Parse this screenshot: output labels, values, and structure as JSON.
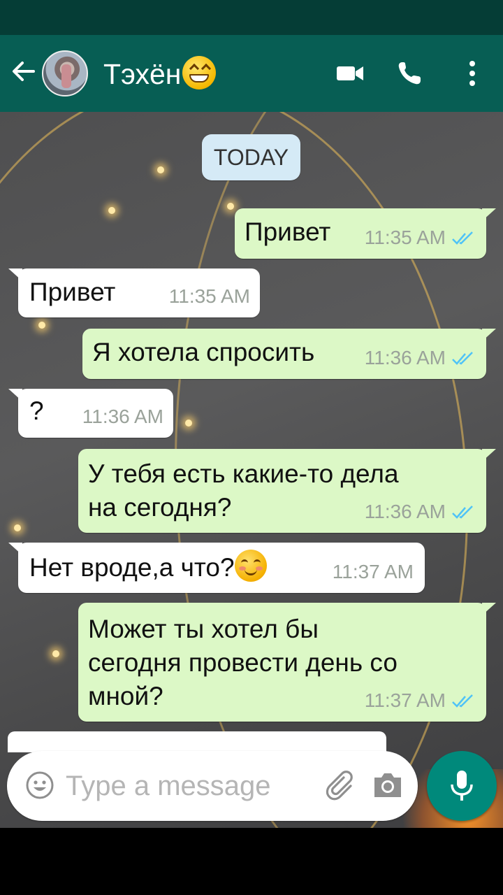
{
  "header": {
    "contact_name": "Тэхён",
    "name_emoji": "grinning-face-icon"
  },
  "chat": {
    "date_chip": "TODAY",
    "messages": [
      {
        "dir": "out",
        "text": "Привет",
        "time": "11:35 AM",
        "status": "read"
      },
      {
        "dir": "in",
        "text": "Привет",
        "time": "11:35 AM"
      },
      {
        "dir": "out",
        "text": "Я хотела спросить",
        "time": "11:36 AM",
        "status": "read"
      },
      {
        "dir": "in",
        "text": "?",
        "time": "11:36 AM"
      },
      {
        "dir": "out",
        "text_lines": [
          "У тебя есть какие-то дела",
          "на сегодня?"
        ],
        "time": "11:36 AM",
        "status": "read"
      },
      {
        "dir": "in",
        "text": "Нет вроде,а что?",
        "emoji": "smiling-face-icon",
        "time": "11:37 AM"
      },
      {
        "dir": "out",
        "text_lines": [
          "Может ты хотел бы",
          "сегодня провести день со",
          "мной?"
        ],
        "time": "11:37 AM",
        "status": "read"
      }
    ]
  },
  "composer": {
    "placeholder": "Type a message"
  },
  "colors": {
    "header": "#075e54",
    "outgoing_bubble": "#dcf8c6",
    "incoming_bubble": "#ffffff",
    "read_ticks": "#4fc3f7",
    "mic_button": "#00897b"
  }
}
